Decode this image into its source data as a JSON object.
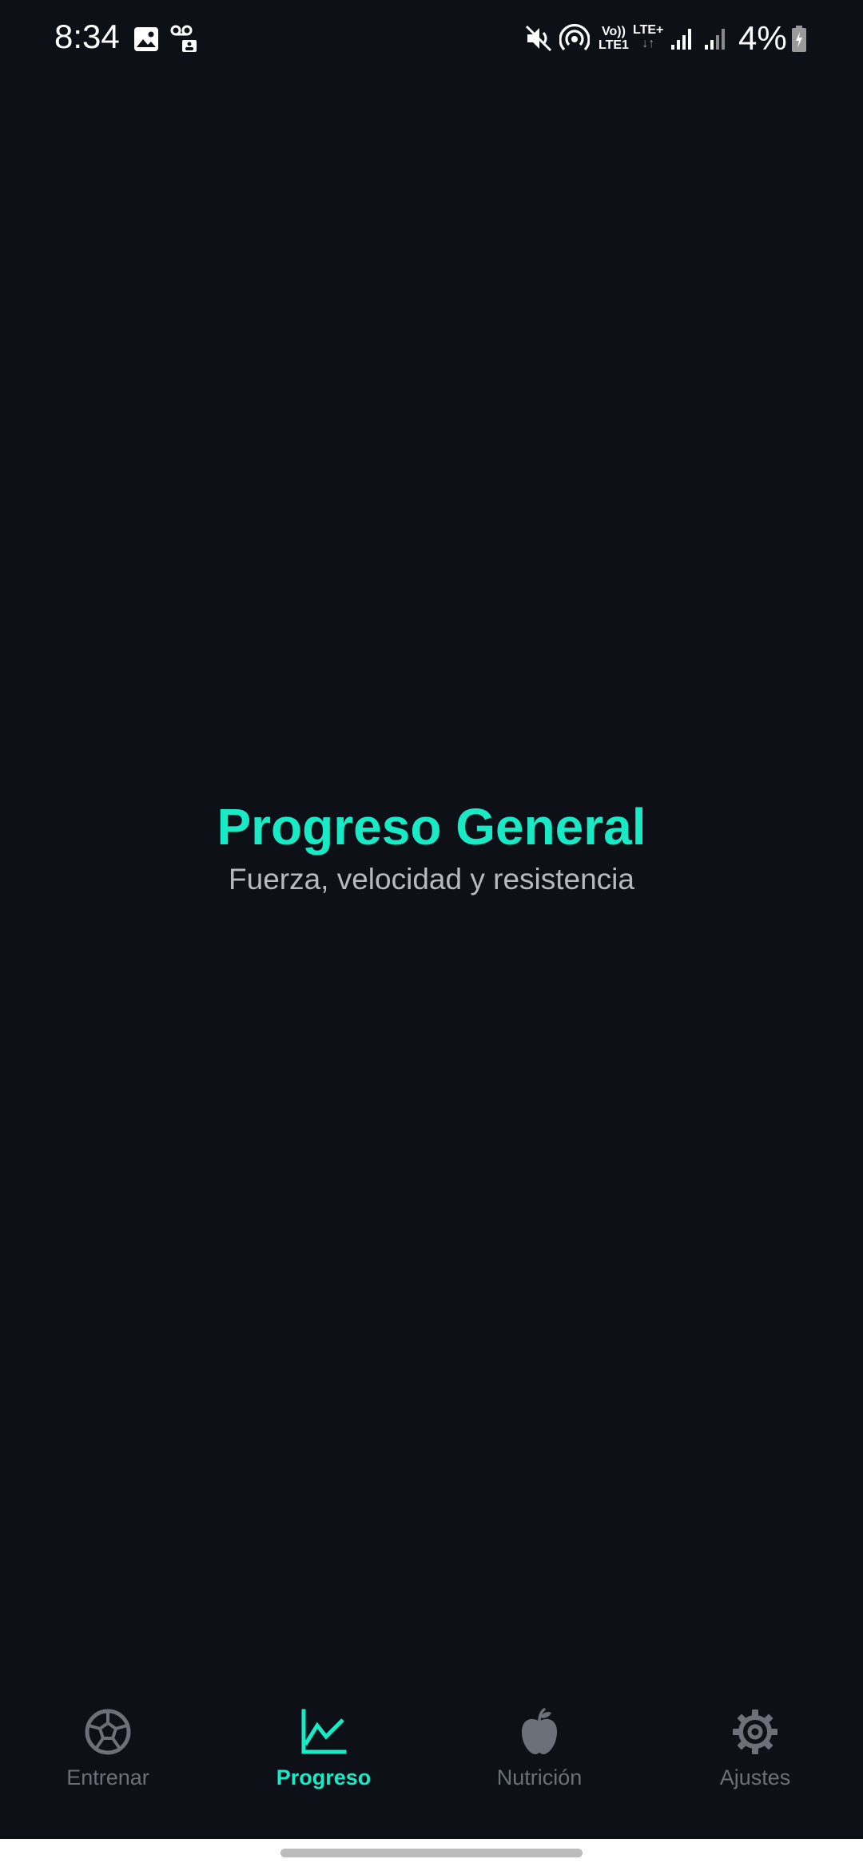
{
  "status_bar": {
    "time": "8:34",
    "volte_top": "Vo))",
    "volte_bottom": "LTE1",
    "lte_label": "LTE+",
    "battery": "4%",
    "icons": [
      "gallery-icon",
      "voicemail-icon",
      "mute-icon",
      "hotspot-icon",
      "volte-icon",
      "lte-data-icon",
      "signal-icon",
      "signal-weak-icon",
      "battery-charging-icon"
    ]
  },
  "main": {
    "title": "Progreso General",
    "subtitle": "Fuerza, velocidad y resistencia"
  },
  "bottom_nav": {
    "items": [
      {
        "label": "Entrenar",
        "icon": "soccer-ball-icon",
        "active": false
      },
      {
        "label": "Progreso",
        "icon": "chart-line-icon",
        "active": true
      },
      {
        "label": "Nutrición",
        "icon": "apple-icon",
        "active": false
      },
      {
        "label": "Ajustes",
        "icon": "gear-icon",
        "active": false
      }
    ]
  },
  "colors": {
    "background": "#0d1017",
    "accent": "#19eac6",
    "inactive": "#6b7079",
    "subtitle": "#b7b9be"
  }
}
